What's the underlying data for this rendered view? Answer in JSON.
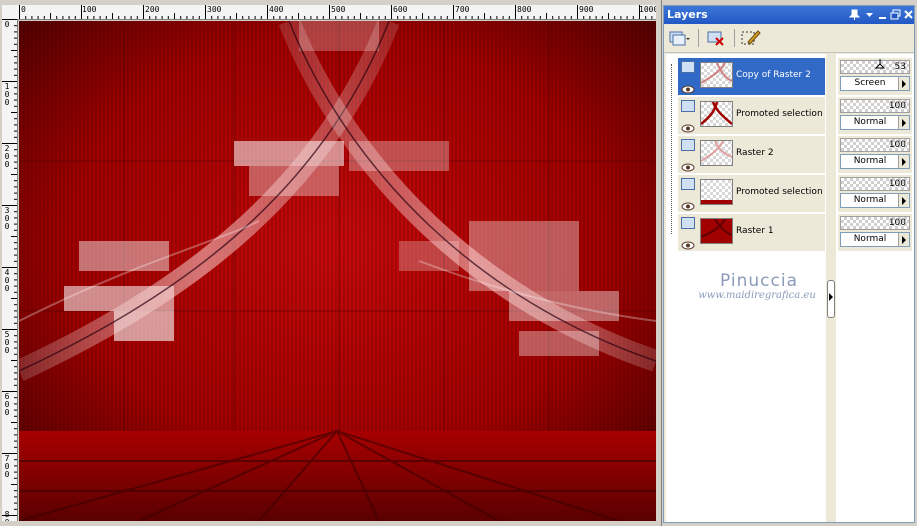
{
  "rulers": {
    "top": [
      "0",
      "100",
      "200",
      "300",
      "400",
      "500",
      "600",
      "700",
      "800",
      "900",
      "1000"
    ],
    "left": [
      "0",
      "100",
      "200",
      "300",
      "400",
      "500",
      "600",
      "700",
      "800"
    ]
  },
  "panel": {
    "title": "Layers",
    "controls": [
      "pin-icon",
      "dropdown-icon",
      "minimize-icon",
      "restore-icon",
      "close-icon"
    ]
  },
  "toolbar": {
    "icons": [
      "new-layer-icon",
      "delete-layer-icon",
      "edit-selection-icon"
    ]
  },
  "layers": [
    {
      "name": "Copy of Raster 2",
      "opacity": "53",
      "blend": "Screen",
      "selected": true
    },
    {
      "name": "Promoted selection",
      "opacity": "100",
      "blend": "Normal",
      "selected": false
    },
    {
      "name": "Raster 2",
      "opacity": "100",
      "blend": "Normal",
      "selected": false
    },
    {
      "name": "Promoted selection 1",
      "opacity": "100",
      "blend": "Normal",
      "selected": false
    },
    {
      "name": "Raster 1",
      "opacity": "100",
      "blend": "Normal",
      "selected": false
    }
  ],
  "watermark": {
    "name": "Pinuccia",
    "url": "www.maidiregrafica.eu"
  },
  "colors": {
    "accent": "#3169c6",
    "canvas_red": "#b80000"
  }
}
